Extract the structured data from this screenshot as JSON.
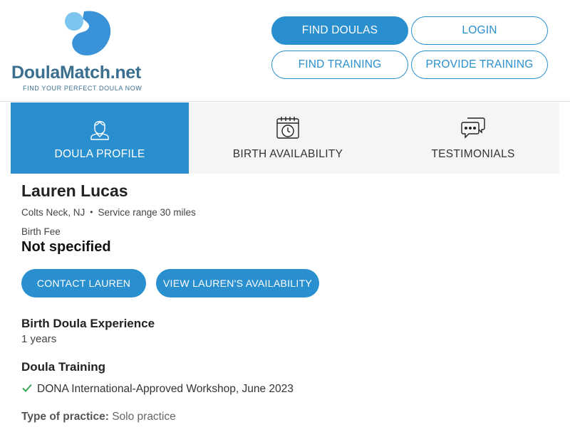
{
  "header": {
    "logo": {
      "brand_part1": "Doula",
      "brand_part2": "Match",
      "brand_part3": ".net",
      "tagline": "FIND YOUR PERFECT DOULA NOW"
    },
    "nav": {
      "find_doulas": "FIND DOULAS",
      "login": "LOGIN",
      "find_training": "FIND TRAINING",
      "provide_training": "PROVIDE TRAINING"
    }
  },
  "tabs": [
    {
      "label": "DOULA PROFILE",
      "icon": "person-icon",
      "active": true
    },
    {
      "label": "BIRTH AVAILABILITY",
      "icon": "calendar-clock-icon",
      "active": false
    },
    {
      "label": "TESTIMONIALS",
      "icon": "chat-bubbles-icon",
      "active": false
    }
  ],
  "profile": {
    "name": "Lauren Lucas",
    "location": "Colts Neck, NJ",
    "separator": "•",
    "service_range": "Service range 30 miles",
    "birth_fee_label": "Birth Fee",
    "birth_fee_value": "Not specified",
    "contact_button": "CONTACT LAUREN",
    "availability_button": "VIEW LAUREN'S AVAILABILITY",
    "experience_heading": "Birth Doula Experience",
    "experience_value": "1 years",
    "training_heading": "Doula Training",
    "training_items": [
      "DONA International-Approved Workshop, June 2023"
    ],
    "practice_label": "Type of practice:",
    "practice_value": "Solo practice"
  },
  "colors": {
    "accent": "#2a8fcf",
    "logo_text": "#3a6f8f",
    "logo_light": "#7cc5f0",
    "check": "#3aa655"
  }
}
